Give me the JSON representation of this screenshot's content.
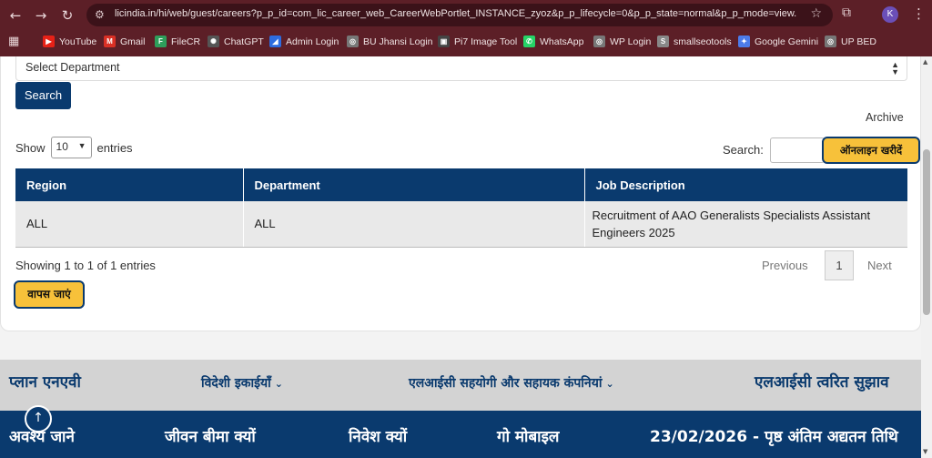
{
  "browser": {
    "url": "licindia.in/hi/web/guest/careers?p_p_id=com_lic_career_web_CareerWebPortlet_INSTANCE_zyoz&p_p_lifecycle=0&p_p_state=normal&p_p_mode=view...",
    "avatar_letter": "K",
    "bookmarks": [
      {
        "label": "YouTube",
        "icon": "youtube-icon",
        "color": "#e62117",
        "glyph": "▶"
      },
      {
        "label": "Gmail",
        "icon": "gmail-icon",
        "color": "#d93025",
        "glyph": "M"
      },
      {
        "label": "FileCR",
        "icon": "filecr-icon",
        "color": "#2e9e5b",
        "glyph": "F"
      },
      {
        "label": "ChatGPT",
        "icon": "chatgpt-icon",
        "color": "#555555",
        "glyph": "✺"
      },
      {
        "label": "Admin Login",
        "icon": "admin-login-icon",
        "color": "#2d6cdf",
        "glyph": "◢"
      },
      {
        "label": "BU Jhansi Login",
        "icon": "globe-icon",
        "color": "#777777",
        "glyph": "◎"
      },
      {
        "label": "Pi7 Image Tool",
        "icon": "pi7-icon",
        "color": "#444444",
        "glyph": "▣"
      },
      {
        "label": "WhatsApp",
        "icon": "whatsapp-icon",
        "color": "#25d366",
        "glyph": "✆"
      },
      {
        "label": "WP Login",
        "icon": "globe-icon",
        "color": "#777777",
        "glyph": "◎"
      },
      {
        "label": "smallseotools",
        "icon": "smallseotools-icon",
        "color": "#888888",
        "glyph": "S"
      },
      {
        "label": "Google Gemini",
        "icon": "gemini-icon",
        "color": "#4c7be8",
        "glyph": "✦"
      },
      {
        "label": "UP BED",
        "icon": "globe-icon",
        "color": "#777777",
        "glyph": "◎"
      }
    ]
  },
  "form": {
    "department_placeholder": "Select Department",
    "search_button": "Search",
    "archive_link": "Archive"
  },
  "table_controls": {
    "show_label": "Show",
    "entries_value": "10",
    "entries_label": "entries",
    "search_label": "Search:",
    "online_buy_button": "ऑनलाइन खरीदें"
  },
  "jobs_table": {
    "columns": [
      "Region",
      "Department",
      "Job Description"
    ],
    "rows": [
      {
        "region": "ALL",
        "department": "ALL",
        "description": "Recruitment of AAO Generalists Specialists Assistant Engineers 2025"
      }
    ]
  },
  "pagination": {
    "info": "Showing 1 to 1 of 1 entries",
    "previous": "Previous",
    "current_page": "1",
    "next": "Next"
  },
  "back_button": "वापस जाएं",
  "footer_light": {
    "items": [
      "प्लान एनएवी",
      "विदेशी इकाईयाँ",
      "एलआईसी सहयोगी और सहायक कंपनियां",
      "एलआईसी त्वरित सुझाव"
    ]
  },
  "footer_dark": {
    "items": [
      "अवश्य जाने",
      "जीवन बीमा क्यों",
      "निवेश क्यों",
      "गो मोबाइल",
      "23/02/2026 - पृष्ठ अंतिम अद्यतन तिथि"
    ]
  },
  "colors": {
    "primary_blue": "#0a3a6e",
    "accent_yellow": "#f7c13a",
    "browser_frame": "#5c1f27"
  }
}
